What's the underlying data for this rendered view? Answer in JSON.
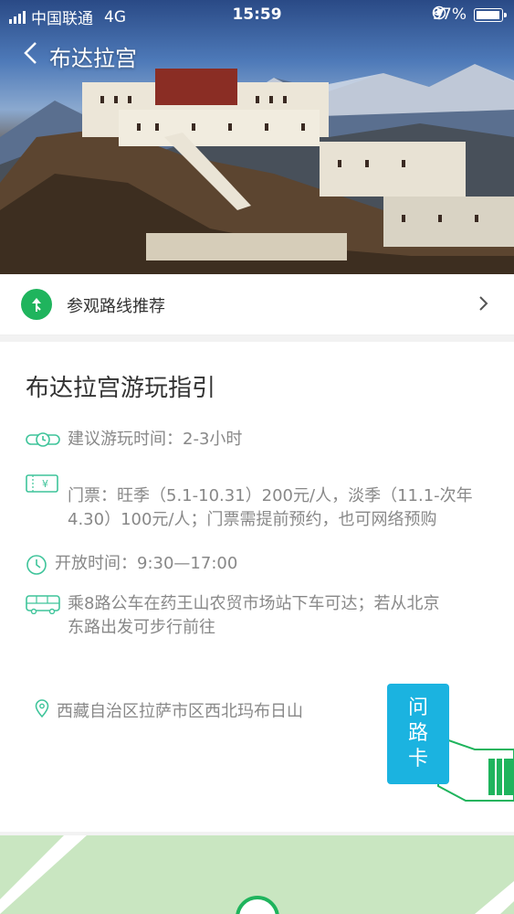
{
  "status_bar": {
    "carrier": "中国联通",
    "network": "4G",
    "time": "15:59",
    "battery": "97%"
  },
  "nav": {
    "title": "布达拉宫",
    "back_icon": "chevron-left-icon"
  },
  "route_card": {
    "label": "参观路线推荐",
    "icon": "route-icon"
  },
  "guide": {
    "title": "布达拉宫游玩指引",
    "duration": "建议游玩时间：2-3小时",
    "ticket_line1": "门票：旺季（5.1-10.31）200元/人，淡季（11.1-次年",
    "ticket_line2": "4.30）100元/人；门票需提前预约，也可网络预购",
    "hours": "开放时间：9:30—17:00",
    "transit_line1": "乘8路公车在药王山农贸市场站下车可达；若从北京",
    "transit_line2": "东路出发可步行前往",
    "address": "西藏自治区拉萨市区西北玛布日山"
  },
  "ask_card": {
    "char1": "问",
    "char2": "路",
    "char3": "卡"
  },
  "colors": {
    "accent_green": "#1fb45d",
    "icon_teal": "#3ec49a",
    "ask_blue": "#1bb3e0"
  }
}
